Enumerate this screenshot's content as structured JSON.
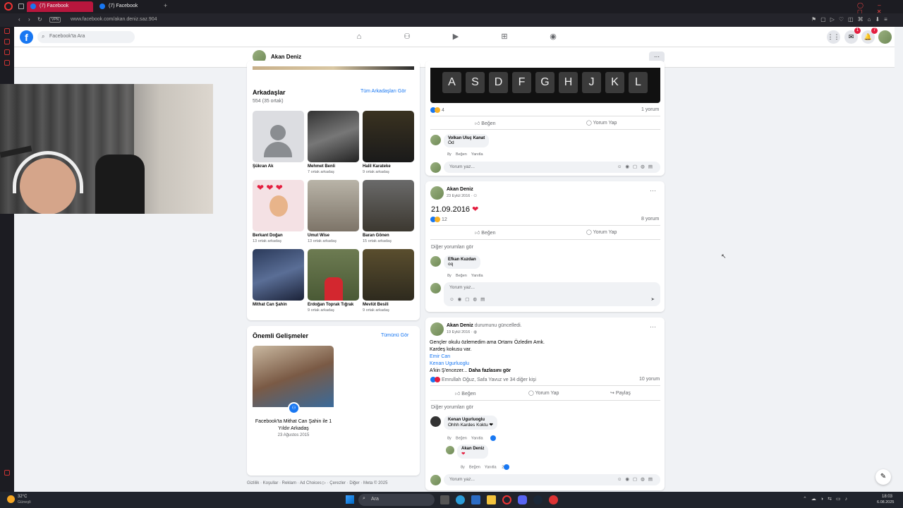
{
  "browser": {
    "tabs": [
      "(7) Facebook",
      "(7) Facebook"
    ],
    "new_tab": "+",
    "vpn": "VPN",
    "url": "www.facebook.com/akan.deniz.saz.904"
  },
  "fb": {
    "logo": "f",
    "search_placeholder": "Facebook'ta Ara",
    "messenger_badge": "1",
    "notifications_badge": "7"
  },
  "profile": {
    "name": "Akan Deniz",
    "more": "···"
  },
  "friends": {
    "title": "Arkadaşlar",
    "count": "554 (35 ortak)",
    "see_all": "Tüm Arkadaşları Gör",
    "items": [
      {
        "name": "Şükran Ak",
        "mutual": ""
      },
      {
        "name": "Mehmet Benli",
        "mutual": "7 ortak arkadaş"
      },
      {
        "name": "Halil Karateke",
        "mutual": "9 ortak arkadaş"
      },
      {
        "name": "Berkant Doğan",
        "mutual": "13 ortak arkadaş"
      },
      {
        "name": "Umut Wise",
        "mutual": "13 ortak arkadaş"
      },
      {
        "name": "Baran Gönen",
        "mutual": "15 ortak arkadaş"
      },
      {
        "name": "Mithat Can Şahin",
        "mutual": ""
      },
      {
        "name": "Erdoğan Toprak Tığrak",
        "mutual": "9 ortak arkadaş"
      },
      {
        "name": "Mevlüt Besili",
        "mutual": "9 ortak arkadaş"
      }
    ]
  },
  "events": {
    "title": "Önemli Gelişmeler",
    "see_all": "Tümünü Gör",
    "event_text": "Facebook'ta Mithat Can Şahin ile 1 Yıldır Arkadaş",
    "event_date": "23 Ağustos 2015"
  },
  "footer": "Gizlilik · Koşullar · Reklam · Ad Choices ▷ · Çerezler · Diğer · Meta © 2025",
  "post1": {
    "keys": [
      "A",
      "S",
      "D",
      "F",
      "G",
      "H",
      "J",
      "K",
      "L"
    ],
    "reactions": "4",
    "comments": "1 yorum",
    "like": "Beğen",
    "comment": "Yorum Yap",
    "c1_name": "Volkan Uluç Kanat",
    "c1_text": "Öd",
    "reply_time": "8y",
    "reply_like": "Beğen",
    "reply_reply": "Yanıtla",
    "input_placeholder": "Yorum yaz..."
  },
  "post2": {
    "author": "Akan Deniz",
    "date": "23 Eylül 2016 · ",
    "text": "21.09.2016",
    "heart": "❤",
    "reactions": "12",
    "comments": "8 yorum",
    "like": "Beğen",
    "comment": "Yorum Yap",
    "see_more": "Diğer yorumları gör",
    "c1_name": "Efkan Kuzdan",
    "c1_text": "oq",
    "reply_time": "8y",
    "reply_like": "Beğen",
    "reply_reply": "Yanıtla",
    "input_placeholder": "Yorum yaz..."
  },
  "post3": {
    "author": "Akan Deniz",
    "action": " durumunu güncelledi.",
    "date": "19 Eylül 2016 · ",
    "line1": "Gençler okulu özlemedim ama Ortamı Özledim Amk.",
    "line2": "Kardeş kokusu var.",
    "mention1": "Emir Can",
    "mention2": "Kenan Ugurluoglu",
    "line3": "A'kin Ş'encezer... ",
    "see_more_text": "Daha fazlasını gör",
    "reactions": "Emrullah Oğuz, Safa Yavuz ve 34 diğer kişi",
    "comments": "10 yorum",
    "like": "Beğen",
    "comment": "Yorum Yap",
    "share": "Paylaş",
    "see_more": "Diğer yorumları gör",
    "c1_name": "Kenan Ugurluoglu",
    "c1_text": "Ohhh Kardes Koktu ❤",
    "c2_name": "Akan Deniz",
    "c2_text": "❤",
    "c2_count": "2",
    "reply_time": "8y",
    "reply_like": "Beğen",
    "reply_reply": "Yanıtla",
    "input_placeholder": "Yorum yaz..."
  },
  "taskbar": {
    "temp": "32°C",
    "weather": "Güneşli",
    "search": "Ara",
    "time": "18:03",
    "date": "6.08.2025"
  },
  "colors": {
    "fb_blue": "#1877f2",
    "opera_red": "#b8163d",
    "like_blue": "#1877f2",
    "heart_red": "#e41e3f"
  }
}
